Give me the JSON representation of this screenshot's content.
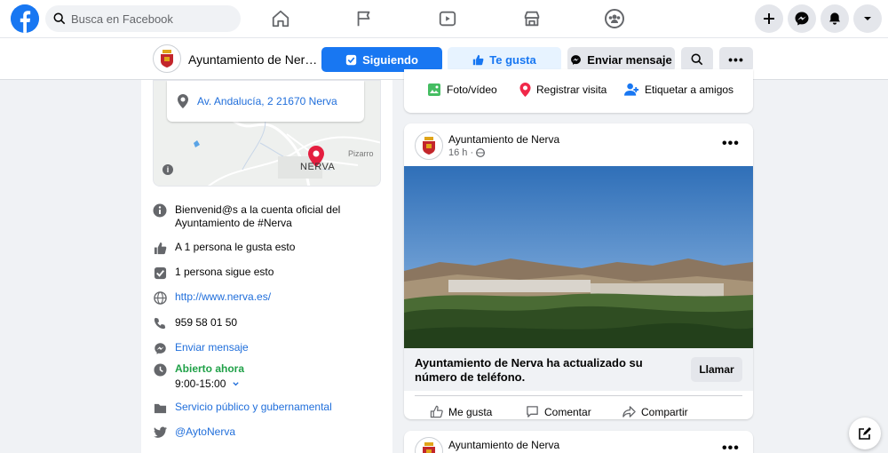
{
  "topbar": {
    "logo": "facebook-logo",
    "search_placeholder": "Busca en Facebook",
    "nav_icons": [
      "home-icon",
      "pages-flag-icon",
      "watch-icon",
      "marketplace-icon",
      "groups-icon"
    ],
    "right_icons": [
      "plus-icon",
      "messenger-icon",
      "notifications-bell-icon",
      "account-chevron-icon"
    ]
  },
  "page_header": {
    "page_name": "Ayuntamiento de Ner…",
    "following_label": "Siguiendo",
    "like_label": "Te gusta",
    "message_label": "Enviar mensaje",
    "colors": {
      "primary": "#1877f2",
      "like_bg": "#e7f3ff"
    }
  },
  "left": {
    "address": "Av. Andalucía, 2 21670 Nerva",
    "map_label_town": "NERVA",
    "map_label_place": "Pizarro",
    "info": {
      "about": "Bienvenid@s a la cuenta oficial del Ayuntamiento de #Nerva",
      "likes": "A 1 persona le gusta esto",
      "follows": "1 persona sigue esto",
      "website": "http://www.nerva.es/",
      "phone": "959 58 01 50",
      "message": "Enviar mensaje",
      "open_now": "Abierto ahora",
      "hours": "9:00-15:00",
      "category": "Servicio público y gubernamental",
      "twitter": "@AytoNerva"
    }
  },
  "composer_actions": {
    "photo": "Foto/vídeo",
    "checkin": "Registrar visita",
    "tag": "Etiquetar a amigos"
  },
  "post": {
    "author": "Ayuntamiento de Nerva",
    "time": "16 h ·",
    "cta_text": "Ayuntamiento de Nerva ha actualizado su número de teléfono.",
    "call_label": "Llamar",
    "like_label": "Me gusta",
    "comment_label": "Comentar",
    "share_label": "Compartir"
  },
  "post2": {
    "author": "Ayuntamiento de Nerva"
  }
}
